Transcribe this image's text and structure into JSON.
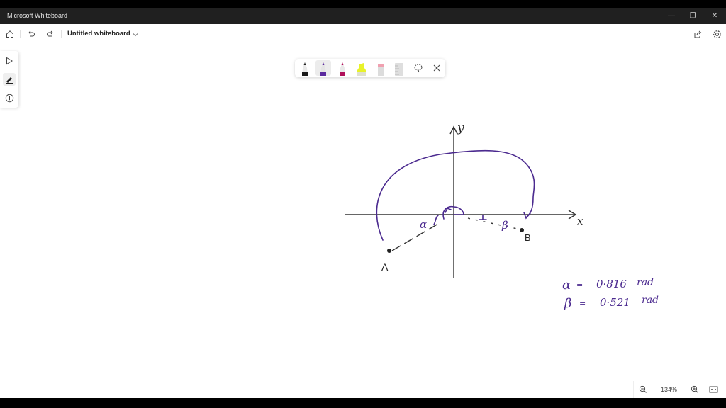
{
  "window": {
    "title": "Microsoft Whiteboard",
    "controls": {
      "minimize": "—",
      "restore": "❐",
      "close": "✕"
    }
  },
  "header": {
    "document_title": "Untitled whiteboard",
    "icons": [
      "home-icon",
      "undo-icon",
      "redo-icon",
      "chevron-down-icon",
      "share-icon",
      "settings-icon"
    ]
  },
  "left_toolbar": {
    "items": [
      {
        "name": "select-tool",
        "icon": "pointer-icon",
        "active": false
      },
      {
        "name": "ink-tool",
        "icon": "pen-icon",
        "active": true
      },
      {
        "name": "add-tool",
        "icon": "plus-circle-icon",
        "active": false
      }
    ]
  },
  "ink_toolbar": {
    "tools": [
      {
        "name": "pen-black",
        "color": "#1a1a1a",
        "active": false
      },
      {
        "name": "pen-purple",
        "color": "#5b2a9e",
        "active": true
      },
      {
        "name": "pen-magenta",
        "color": "#b0105a",
        "active": false
      },
      {
        "name": "highlighter-yellow",
        "color": "#e8f22a",
        "active": false
      },
      {
        "name": "eraser",
        "color": "#f0a0b0",
        "active": false
      },
      {
        "name": "ruler",
        "color": "#d8d8d8",
        "active": false
      },
      {
        "name": "lasso-select",
        "icon": "lasso-icon"
      },
      {
        "name": "close",
        "icon": "close-icon"
      }
    ]
  },
  "drawing": {
    "axis_x_label": "x",
    "axis_y_label": "y",
    "point_a_label": "A",
    "point_b_label": "B",
    "alpha_label": "α",
    "beta_label": "β",
    "perp_mark": "⊥",
    "ink_color": "#4b2a8f",
    "axis_color": "#333333",
    "equations": [
      {
        "symbol": "α",
        "eq": "=",
        "value": "0·816",
        "unit": "rad"
      },
      {
        "symbol": "β",
        "eq": "=",
        "value": "0·521",
        "unit": "rad"
      }
    ]
  },
  "zoom": {
    "level": "134%",
    "icons": [
      "zoom-out-icon",
      "zoom-in-icon",
      "fit-to-screen-icon"
    ]
  }
}
